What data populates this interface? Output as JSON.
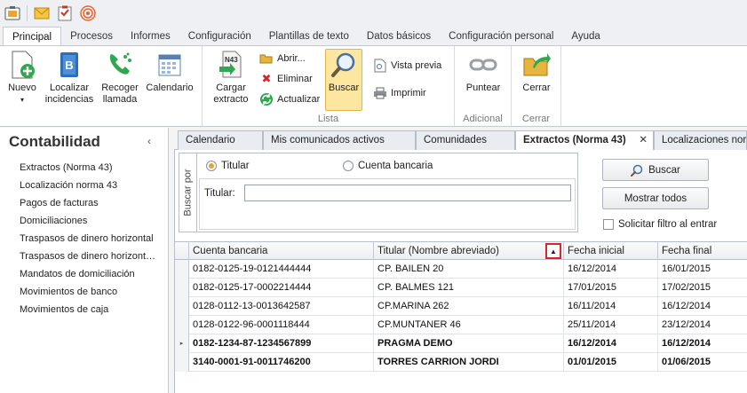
{
  "quick_access": {
    "icons": [
      "app-menu-icon",
      "mail-icon",
      "clipboard-icon",
      "signal-icon"
    ]
  },
  "ribbon_tabs": [
    {
      "label": "Principal",
      "active": true
    },
    {
      "label": "Procesos"
    },
    {
      "label": "Informes"
    },
    {
      "label": "Configuración"
    },
    {
      "label": "Plantillas de texto"
    },
    {
      "label": "Datos básicos"
    },
    {
      "label": "Configuración personal"
    },
    {
      "label": "Ayuda"
    }
  ],
  "ribbon": {
    "nuevo": "Nuevo",
    "localizar_1": "Localizar",
    "localizar_2": "incidencias",
    "recoger_1": "Recoger",
    "recoger_2": "llamada",
    "calendario": "Calendario",
    "cargar_1": "Cargar",
    "cargar_2": "extracto",
    "abrir": "Abrir...",
    "eliminar": "Eliminar",
    "actualizar": "Actualizar",
    "buscar": "Buscar",
    "vista_previa": "Vista previa",
    "imprimir": "Imprimir",
    "puntear": "Puntear",
    "cerrar": "Cerrar",
    "group_lista": "Lista",
    "group_adicional": "Adicional",
    "group_cerrar": "Cerrar",
    "n43_badge": "N43"
  },
  "nav": {
    "title": "Contabilidad",
    "collapse": "‹",
    "items": [
      "Extractos (Norma 43)",
      "Localización norma 43",
      "Pagos de facturas",
      "Domiciliaciones",
      "Traspasos de dinero horizontal",
      "Traspasos de dinero horizont…",
      "Mandatos de domiciliación",
      "Movimientos de banco",
      "Movimientos de caja"
    ]
  },
  "doc_tabs": [
    {
      "label": "Calendario"
    },
    {
      "label": "Mis comunicados activos"
    },
    {
      "label": "Comunidades"
    },
    {
      "label": "Extractos (Norma 43)",
      "active": true,
      "close": "✕"
    },
    {
      "label": "Localizaciones norma"
    }
  ],
  "search": {
    "legend": "Buscar por",
    "radio_titular": "Titular",
    "radio_cuenta": "Cuenta bancaria",
    "titular_label": "Titular:",
    "titular_value": "",
    "buscar": "Buscar",
    "mostrar_todos": "Mostrar todos",
    "filtro": "Solicitar filtro al entrar"
  },
  "grid": {
    "columns": [
      "Cuenta bancaria",
      "Titular (Nombre abreviado)",
      "Fecha inicial",
      "Fecha final"
    ],
    "sort_indicator": "▲",
    "row_marker": "▸",
    "rows": [
      {
        "cuenta": "0182-0125-19-0121444444",
        "titular": "CP. BAILEN 20",
        "inicio": "16/12/2014",
        "fin": "16/01/2015"
      },
      {
        "cuenta": "0182-0125-17-0002214444",
        "titular": "CP. BALMES 121",
        "inicio": "17/01/2015",
        "fin": "17/02/2015"
      },
      {
        "cuenta": "0128-0112-13-0013642587",
        "titular": "CP.MARINA 262",
        "inicio": "16/11/2014",
        "fin": "16/12/2014"
      },
      {
        "cuenta": "0128-0122-96-0001118444",
        "titular": "CP.MUNTANER 46",
        "inicio": "25/11/2014",
        "fin": "23/12/2014"
      },
      {
        "cuenta": "0182-1234-87-1234567899",
        "titular": "PRAGMA DEMO",
        "inicio": "16/12/2014",
        "fin": "16/12/2014"
      },
      {
        "cuenta": "3140-0001-91-0011746200",
        "titular": "TORRES CARRION JORDI",
        "inicio": "01/01/2015",
        "fin": "01/06/2015"
      }
    ]
  },
  "colors": {
    "accent": "#e8a13a",
    "pressed": "#fde6a0",
    "sort_highlight": "#d6262b"
  }
}
